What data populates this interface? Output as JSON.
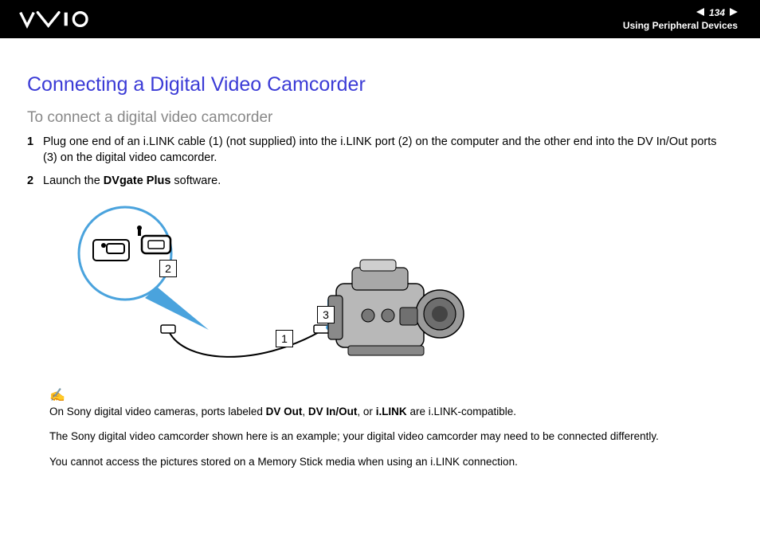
{
  "header": {
    "page_number": "134",
    "section": "Using Peripheral Devices"
  },
  "content": {
    "title": "Connecting a Digital Video Camcorder",
    "subtitle": "To connect a digital video camcorder",
    "steps": [
      {
        "num": "1",
        "text_before": "Plug one end of an i.LINK cable (1) (not supplied) into the i.LINK port (2) on the computer and the other end into the DV In/Out ports (3) on the digital video camcorder."
      },
      {
        "num": "2",
        "text_prefix": "Launch the ",
        "text_bold": "DVgate Plus",
        "text_suffix": " software."
      }
    ],
    "callouts": {
      "c1": "1",
      "c2": "2",
      "c3": "3"
    },
    "notes": {
      "line1_prefix": "On Sony digital video cameras, ports labeled ",
      "line1_b1": "DV Out",
      "line1_sep1": ", ",
      "line1_b2": "DV In/Out",
      "line1_sep2": ", or ",
      "line1_b3": "i.LINK",
      "line1_suffix": " are i.LINK-compatible.",
      "line2": "The Sony digital video camcorder shown here is an example; your digital video camcorder may need to be connected differently.",
      "line3": "You cannot access the pictures stored on a Memory Stick media when using an i.LINK connection."
    }
  }
}
